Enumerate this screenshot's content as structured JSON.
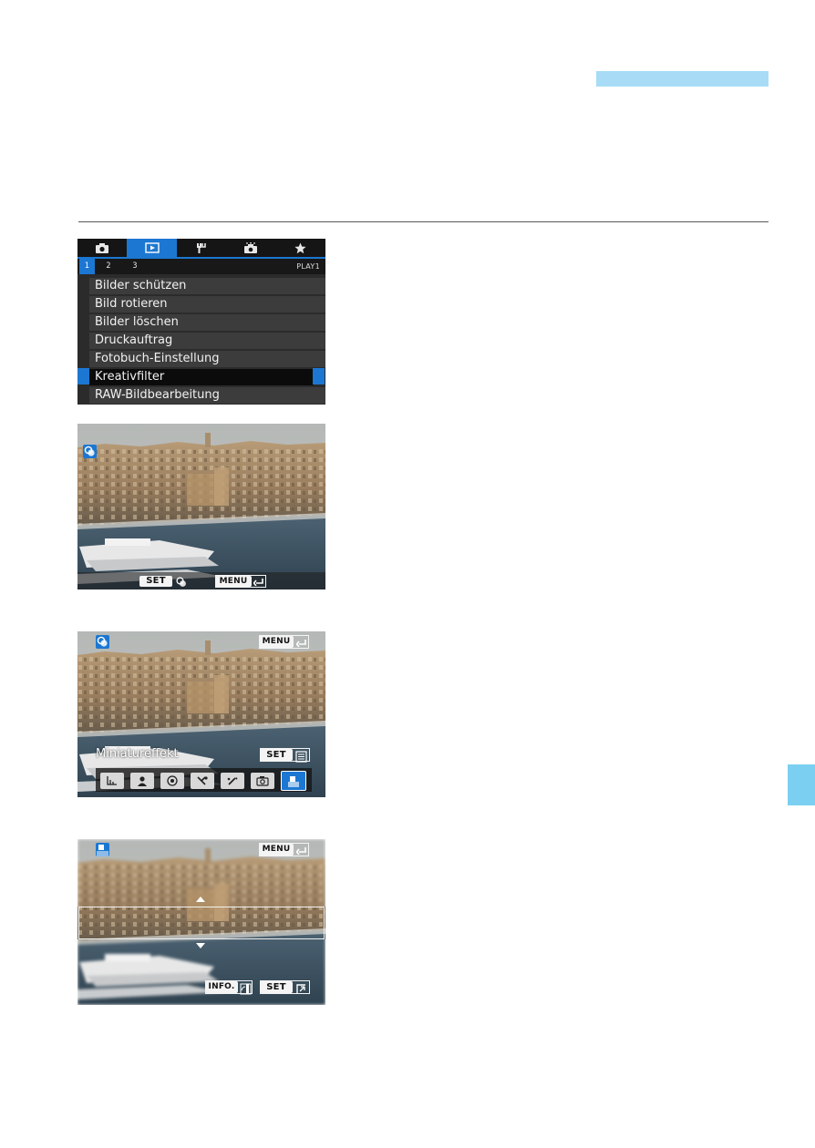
{
  "menu": {
    "subtabs": [
      "1",
      "2",
      "3"
    ],
    "page_label": "PLAY1",
    "items": [
      "Bilder schützen",
      "Bild rotieren",
      "Bilder löschen",
      "Druckauftrag",
      "Fotobuch-Einstellung",
      "Kreativfilter",
      "RAW-Bildbearbeitung"
    ],
    "selected_index": 5,
    "active_tab": "playback"
  },
  "screen2": {
    "set_label": "SET",
    "menu_label": "MENU"
  },
  "screen3": {
    "menu_label": "MENU",
    "filter_name": "Miniatureffekt",
    "set_label": "SET",
    "filters": [
      "grainy-bw",
      "soft-focus",
      "fisheye",
      "art-bold",
      "water-painting",
      "toy-camera",
      "miniature"
    ],
    "active_filter_index": 6
  },
  "screen4": {
    "menu_label": "MENU",
    "info_label": "INFO.",
    "set_label": "SET"
  },
  "colors": {
    "accent_blue": "#1c77d2",
    "header_bar": "#a8dcf6",
    "side_tab": "#7bd0f2"
  }
}
